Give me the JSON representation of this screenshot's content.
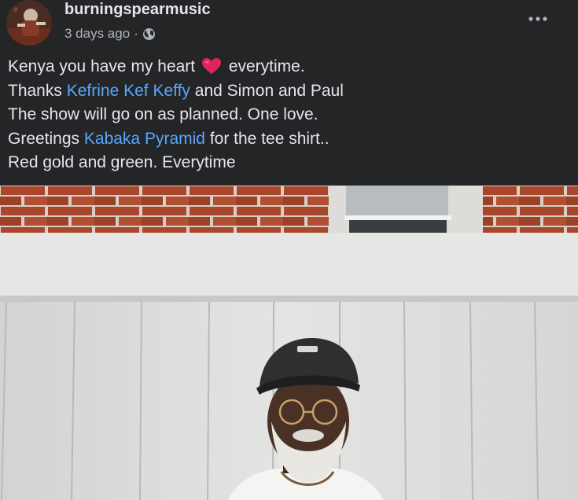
{
  "post": {
    "author": "burningspearmusic",
    "timestamp": "3 days ago",
    "separator": "·",
    "privacy_icon": "globe-icon",
    "more_icon": "more-options-icon",
    "lines": [
      {
        "parts": [
          {
            "text": "Kenya you have my heart "
          },
          {
            "icon": "heart-icon"
          },
          {
            "text": " everytime."
          }
        ]
      },
      {
        "parts": [
          {
            "text": "Thanks "
          },
          {
            "mention": "Kefrine Kef Keffy"
          },
          {
            "text": " and Simon and Paul"
          }
        ]
      },
      {
        "parts": [
          {
            "text": "The show will go on as planned. One love."
          }
        ]
      },
      {
        "parts": [
          {
            "text": "Greetings "
          },
          {
            "mention": "Kabaka Pyramid"
          },
          {
            "text": " for the tee shirt.."
          }
        ]
      },
      {
        "parts": [
          {
            "text": "Red gold and green. Everytime"
          }
        ]
      }
    ],
    "line1_a": "Kenya you have my heart",
    "line1_b": "everytime.",
    "line2_a": "Thanks",
    "line2_mention": "Kefrine Kef Keffy",
    "line2_b": "and Simon and Paul",
    "line3": "The show will go on as planned. One love.",
    "line4_a": "Greetings",
    "line4_mention": "Kabaka Pyramid",
    "line4_b": "for the tee shirt..",
    "line5": "Red gold and green. Everytime"
  },
  "colors": {
    "background": "#242526",
    "primary_text": "#e4e6eb",
    "secondary_text": "#b0b3b8",
    "mention": "#5aa7ff",
    "heart": "#e0245e"
  }
}
